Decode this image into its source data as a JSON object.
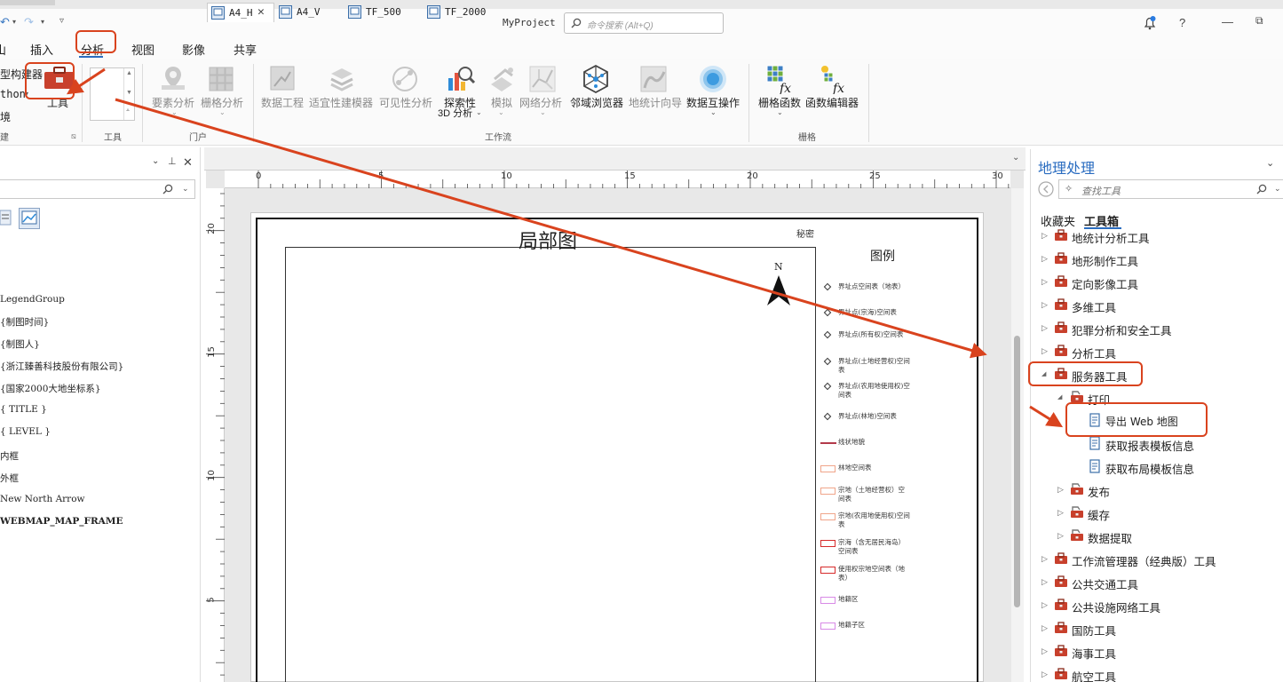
{
  "app": {
    "project_name": "MyProject"
  },
  "command_search": {
    "placeholder": "命令搜索 (Alt+Q)"
  },
  "menu": {
    "items": [
      "插入",
      "分析",
      "视图",
      "影像",
      "共享"
    ],
    "active": "分析",
    "partial_first": "山"
  },
  "ribbon": {
    "left_partial": [
      "型构建器",
      "thon",
      "境"
    ],
    "tools_button": "工具",
    "group_tools": "工具",
    "group_portal": "门户",
    "group_workflow": "工作流",
    "group_raster": "栅格",
    "group_left": "建",
    "buttons": {
      "feature_analysis": "要素分析",
      "raster_analysis": "栅格分析",
      "data_engineering": "数据工程",
      "suitability_modeler": "适宜性建模器",
      "visibility_analysis": "可见性分析",
      "explore_3d_line1": "探索性",
      "explore_3d_line2": "3D 分析",
      "simulation": "模拟",
      "network_analysis": "网络分析",
      "neighborhood_explorer": "邻域浏览器",
      "geostatistical_wizard": "地统计向导",
      "data_interop": "数据互操作",
      "raster_functions": "栅格函数",
      "function_editor": "函数编辑器"
    }
  },
  "left_pane": {
    "items": [
      "LegendGroup",
      "{制图时间}",
      "{制图人}",
      "{浙江臻善科技股份有限公司}",
      "{国家2000大地坐标系}",
      "{ TITLE }",
      "{ LEVEL }",
      "外框",
      "内框",
      "New North Arrow",
      "WEBMAP_MAP_FRAME"
    ]
  },
  "doc_tabs": [
    "A4_H",
    "A4_V",
    "TF_500",
    "TF_2000"
  ],
  "ruler": {
    "h": [
      "0",
      "5",
      "10",
      "15",
      "20",
      "25",
      "30"
    ],
    "v": [
      "20",
      "15",
      "10",
      "5"
    ]
  },
  "layout": {
    "title": "局部图",
    "secret": "秘密",
    "north": "N",
    "legend_title": "图例",
    "legend_items": [
      {
        "kind": "point",
        "label": "界址点空间表（地表）"
      },
      {
        "kind": "point",
        "label": "界址点(宗海)空间表"
      },
      {
        "kind": "point",
        "label": "界址点(所有权)空间表"
      },
      {
        "kind": "point",
        "label": "界址点(土地经营权)空间表"
      },
      {
        "kind": "point",
        "label": "界址点(农用地使用权)空间表"
      },
      {
        "kind": "point",
        "label": "界址点(林地)空间表"
      },
      {
        "kind": "line",
        "label": "线状地貌"
      },
      {
        "kind": "rect",
        "color": "#f0a58a",
        "label": "林地空间表"
      },
      {
        "kind": "rect",
        "color": "#f0a58a",
        "label": "宗地（土地经营权）空间表"
      },
      {
        "kind": "rect",
        "color": "#f0a58a",
        "label": "宗地(农用地使用权)空间表"
      },
      {
        "kind": "rect",
        "color": "#d62a2a",
        "label": "宗海（含无居民海岛）空间表"
      },
      {
        "kind": "rect",
        "color": "#d62a2a",
        "label": "使用权宗地空间表（地表）"
      },
      {
        "kind": "rect",
        "color": "#d88ae6",
        "label": "地籍区"
      },
      {
        "kind": "rect",
        "color": "#d88ae6",
        "label": "地籍子区"
      }
    ]
  },
  "geoprocessing": {
    "title": "地理处理",
    "search_placeholder": "查找工具",
    "tab_favorites": "收藏夹",
    "tab_toolboxes": "工具箱",
    "tree": [
      {
        "label": "地统计分析工具",
        "level": 0,
        "state": "collapsed",
        "type": "toolbox"
      },
      {
        "label": "地形制作工具",
        "level": 0,
        "state": "collapsed",
        "type": "toolbox"
      },
      {
        "label": "定向影像工具",
        "level": 0,
        "state": "collapsed",
        "type": "toolbox"
      },
      {
        "label": "多维工具",
        "level": 0,
        "state": "collapsed",
        "type": "toolbox"
      },
      {
        "label": "犯罪分析和安全工具",
        "level": 0,
        "state": "collapsed",
        "type": "toolbox"
      },
      {
        "label": "分析工具",
        "level": 0,
        "state": "collapsed",
        "type": "toolbox"
      },
      {
        "label": "服务器工具",
        "level": 0,
        "state": "expanded",
        "type": "toolbox"
      },
      {
        "label": "打印",
        "level": 1,
        "state": "expanded",
        "type": "toolset"
      },
      {
        "label": "导出 Web 地图",
        "level": 2,
        "state": "leaf",
        "type": "tool"
      },
      {
        "label": "获取报表模板信息",
        "level": 2,
        "state": "leaf",
        "type": "tool"
      },
      {
        "label": "获取布局模板信息",
        "level": 2,
        "state": "leaf",
        "type": "tool"
      },
      {
        "label": "发布",
        "level": 1,
        "state": "collapsed",
        "type": "toolset"
      },
      {
        "label": "缓存",
        "level": 1,
        "state": "collapsed",
        "type": "toolset"
      },
      {
        "label": "数据提取",
        "level": 1,
        "state": "collapsed",
        "type": "toolset"
      },
      {
        "label": "工作流管理器（经典版）工具",
        "level": 0,
        "state": "collapsed",
        "type": "toolbox"
      },
      {
        "label": "公共交通工具",
        "level": 0,
        "state": "collapsed",
        "type": "toolbox"
      },
      {
        "label": "公共设施网络工具",
        "level": 0,
        "state": "collapsed",
        "type": "toolbox"
      },
      {
        "label": "国防工具",
        "level": 0,
        "state": "collapsed",
        "type": "toolbox"
      },
      {
        "label": "海事工具",
        "level": 0,
        "state": "collapsed",
        "type": "toolbox"
      },
      {
        "label": "航空工具",
        "level": 0,
        "state": "collapsed",
        "type": "toolbox"
      }
    ]
  },
  "colors": {
    "accent": "#2a6cc0",
    "annotation": "#d9431e",
    "toolbox": "#c8402c"
  }
}
